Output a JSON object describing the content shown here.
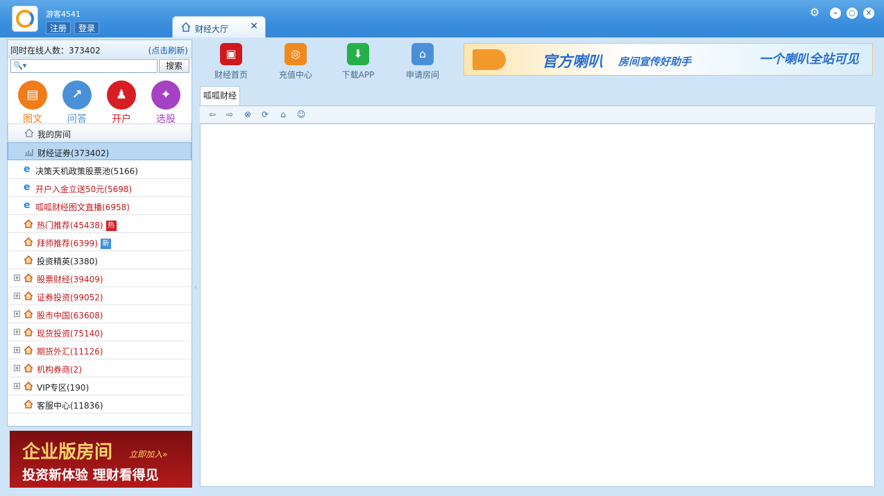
{
  "titlebar": {
    "username": "游客4541",
    "register_label": "注册",
    "login_label": "登录",
    "active_tab": "财经大厅",
    "tab_close": "✕"
  },
  "sidebar": {
    "online_text": "同时在线人数：373402",
    "refresh_label": "(点击刷新)",
    "search_placeholder": "",
    "search_button": "搜索",
    "quick_links": [
      {
        "label": "图文",
        "color": "#f07c1a"
      },
      {
        "label": "问答",
        "color": "#4a90d9"
      },
      {
        "label": "开户",
        "color": "#d61e24"
      },
      {
        "label": "选股",
        "color": "#a542c4"
      }
    ],
    "tree": [
      {
        "label": "我的房间"
      },
      {
        "label": "财经证券(373402)"
      },
      {
        "label": "决策天机政策股票池(5166)"
      },
      {
        "label": "开户入金立送50元(5698)"
      },
      {
        "label": "呱呱财经图文直播(6958)"
      },
      {
        "label": "热门推荐(45438)",
        "badge": "热"
      },
      {
        "label": "拜师推荐(6399)",
        "badge": "新"
      },
      {
        "label": "投资精英(3380)"
      },
      {
        "label": "股票财经(39409)"
      },
      {
        "label": "证券投资(99052)"
      },
      {
        "label": "股市中国(63608)"
      },
      {
        "label": "现货投资(75140)"
      },
      {
        "label": "期货外汇(11126)"
      },
      {
        "label": "机构券商(2)"
      },
      {
        "label": "VIP专区(190)"
      },
      {
        "label": "客服中心(11836)"
      }
    ],
    "banner": {
      "line1": "企业版房间",
      "line1_small": "立即加入»",
      "line2": "投资新体验  理财看得见"
    }
  },
  "toolbar": [
    {
      "label": "财经首页",
      "color": "#d0191d"
    },
    {
      "label": "充值中心",
      "color": "#f08a1f"
    },
    {
      "label": "下载APP",
      "color": "#27b04a"
    },
    {
      "label": "申请房间",
      "color": "#4a90d9"
    }
  ],
  "ad": {
    "t1": "官方喇叭",
    "t2": "房间宣传好助手",
    "t3": "一个喇叭全站可见"
  },
  "content": {
    "subtab_label": "呱呱财经社区"
  }
}
